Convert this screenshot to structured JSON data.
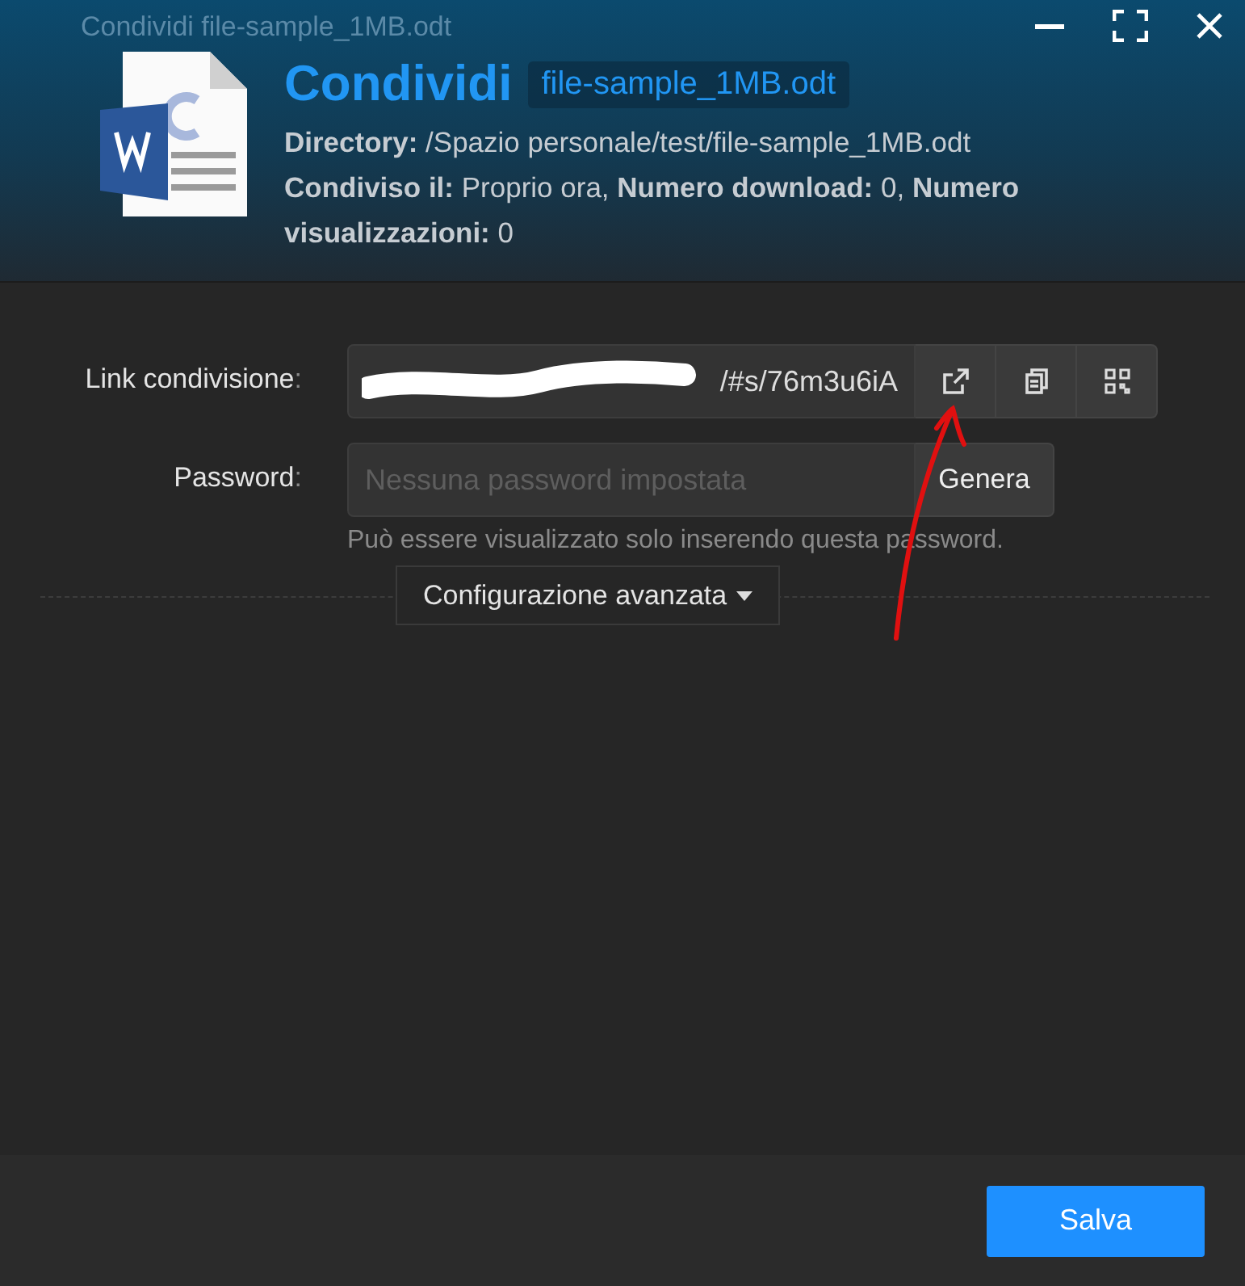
{
  "window": {
    "title": "Condividi file-sample_1MB.odt"
  },
  "header": {
    "title": "Condividi",
    "file_tag": "file-sample_1MB.odt",
    "info": [
      "**Directory:** /Spazio personale/test/file-sample_1MB.odt",
      "**Condiviso il:** Proprio ora, **Numero download:** 0, **Numero visualizzazioni:** 0"
    ]
  },
  "form": {
    "link": {
      "label": "Link condivisione",
      "colon": ":",
      "value": "/#s/76m3u6iA"
    },
    "password": {
      "label": "Password",
      "colon": ":",
      "placeholder": "Nessuna password impostata",
      "button": "Genera",
      "hint": "Può essere visualizzato solo inserendo questa password."
    },
    "advanced": {
      "label": "Configurazione avanzata",
      "expanded": false
    }
  },
  "footer": {
    "save": "Salva"
  }
}
